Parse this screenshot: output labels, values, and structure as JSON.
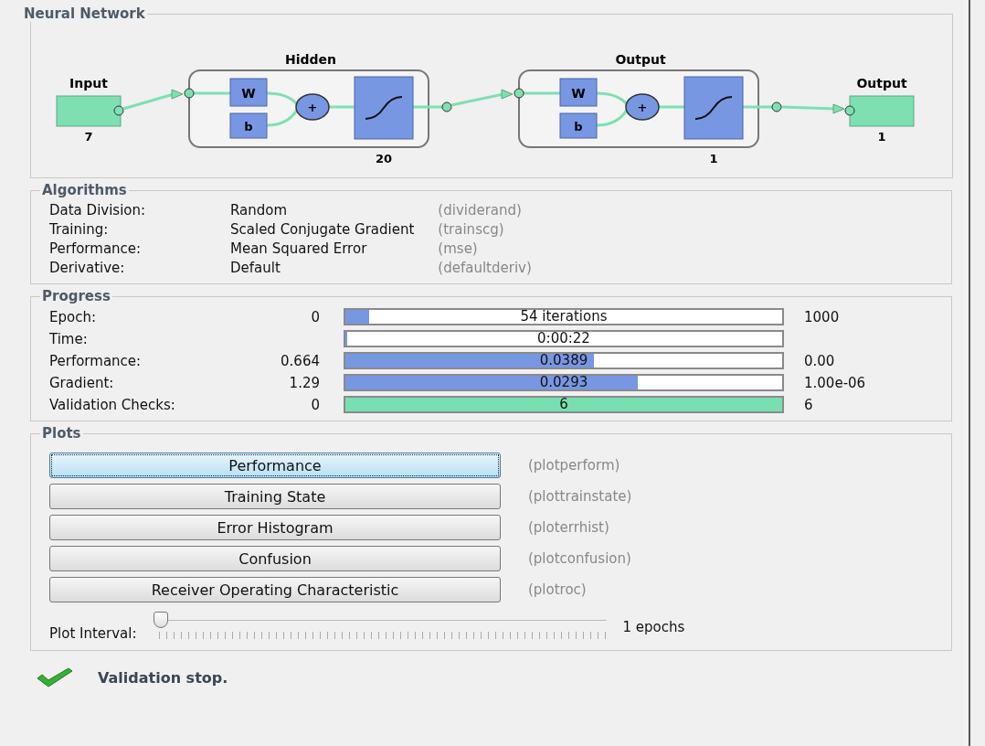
{
  "network": {
    "title": "Neural Network",
    "input": {
      "label": "Input",
      "size": "7"
    },
    "layers": [
      {
        "title": "Hidden",
        "weight": "W",
        "bias": "b",
        "sum": "+",
        "size": "20"
      },
      {
        "title": "Output",
        "weight": "W",
        "bias": "b",
        "sum": "+",
        "size": "1"
      }
    ],
    "output": {
      "label": "Output",
      "size": "1"
    }
  },
  "algorithms": {
    "title": "Algorithms",
    "rows": [
      {
        "label": "Data Division:",
        "value": "Random",
        "function": "(dividerand)"
      },
      {
        "label": "Training:",
        "value": "Scaled Conjugate Gradient",
        "function": "(trainscg)"
      },
      {
        "label": "Performance:",
        "value": "Mean Squared Error",
        "function": "(mse)"
      },
      {
        "label": "Derivative:",
        "value": "Default",
        "function": "(defaultderiv)"
      }
    ]
  },
  "progress": {
    "title": "Progress",
    "rows": [
      {
        "label": "Epoch:",
        "start": "0",
        "reading": "54 iterations",
        "end": "1000",
        "level": 0.054,
        "kind": "blue"
      },
      {
        "label": "Time:",
        "reading": "0:00:22",
        "level": 0.004,
        "kind": "blue"
      },
      {
        "label": "Performance:",
        "start": "0.664",
        "reading": "0.0389",
        "end": "0.00",
        "level": 0.57,
        "kind": "blue"
      },
      {
        "label": "Gradient:",
        "start": "1.29",
        "reading": "0.0293",
        "end": "1.00e-06",
        "level": 0.67,
        "kind": "blue"
      },
      {
        "label": "Validation Checks:",
        "start": "0",
        "reading": "6",
        "end": "6",
        "level": 1,
        "kind": "green"
      }
    ]
  },
  "plots": {
    "title": "Plots",
    "buttons": [
      {
        "label": "Performance",
        "function": "(plotperform)",
        "selected": true
      },
      {
        "label": "Training State",
        "function": "(plottrainstate)",
        "selected": false
      },
      {
        "label": "Error Histogram",
        "function": "(ploterrhist)",
        "selected": false
      },
      {
        "label": "Confusion",
        "function": "(plotconfusion)",
        "selected": false
      },
      {
        "label": "Receiver Operating Characteristic",
        "function": "(plotroc)",
        "selected": false
      }
    ],
    "interval": {
      "label": "Plot Interval:",
      "level": 0,
      "reading": "1 epochs"
    }
  },
  "status": {
    "message": "Validation stop."
  }
}
